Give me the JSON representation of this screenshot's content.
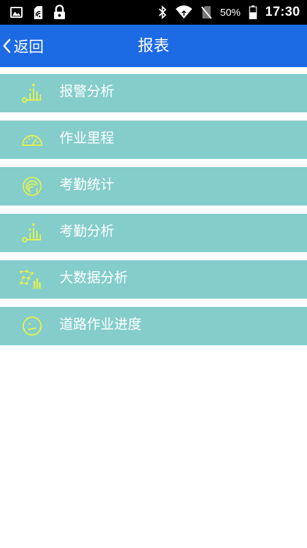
{
  "status_bar": {
    "battery_percent": "50%",
    "time": "17:30"
  },
  "header": {
    "back_label": "返回",
    "title": "报表"
  },
  "colors": {
    "header_bg": "#1d6ae5",
    "item_bg": "#84cdcb",
    "icon_color": "#e2f04f"
  },
  "menu": {
    "items": [
      {
        "label": "报警分析",
        "icon": "bar-chart-icon"
      },
      {
        "label": "作业里程",
        "icon": "speedometer-icon"
      },
      {
        "label": "考勤统计",
        "icon": "fingerprint-icon"
      },
      {
        "label": "考勤分析",
        "icon": "bar-chart-icon"
      },
      {
        "label": "大数据分析",
        "icon": "big-data-icon"
      },
      {
        "label": "道路作业进度",
        "icon": "progress-face-icon"
      }
    ]
  }
}
